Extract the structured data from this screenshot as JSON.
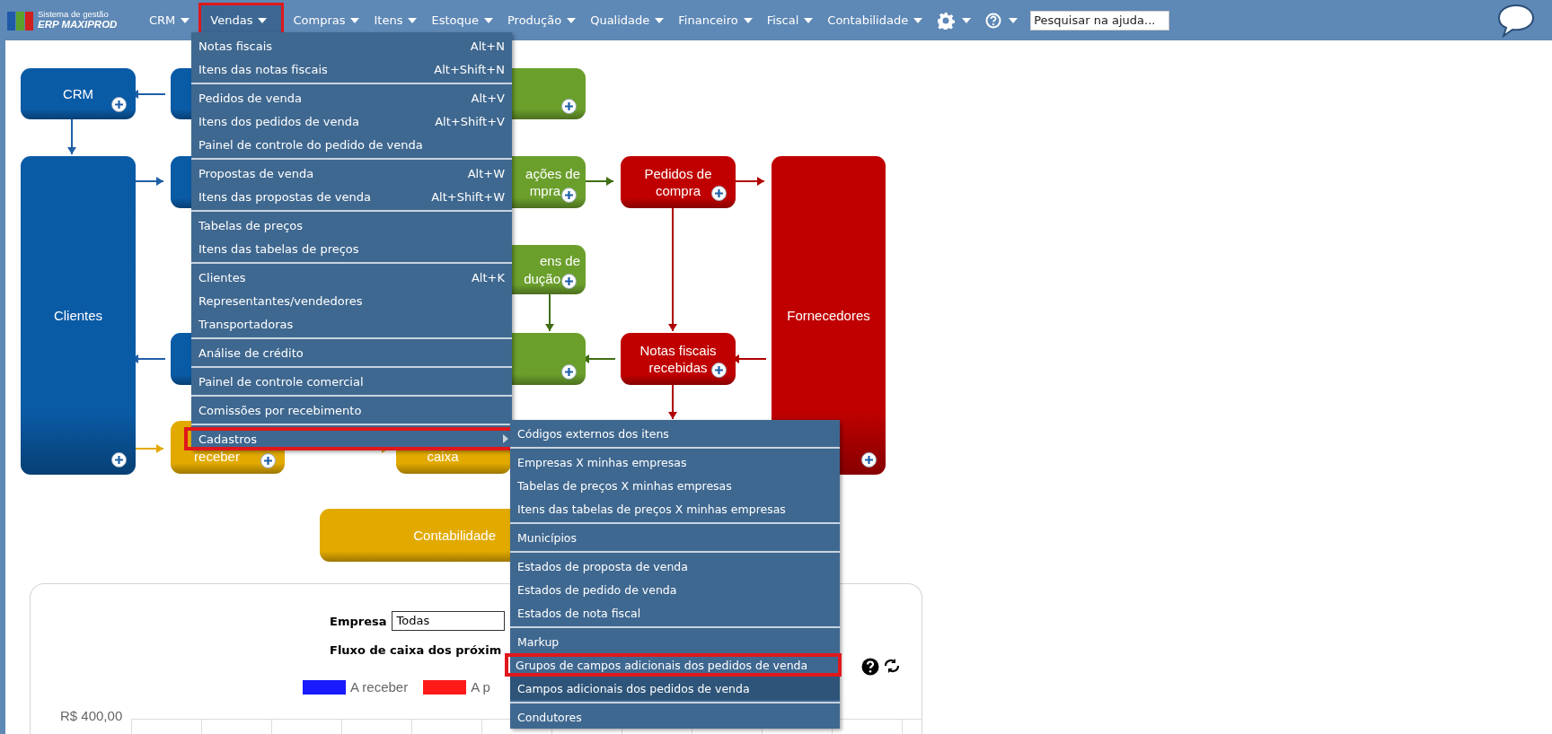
{
  "brand": {
    "subtitle": "Sistema de gestão",
    "name": "ERP MAXIPROD"
  },
  "nav": [
    {
      "label": "CRM",
      "highlighted": false
    },
    {
      "label": "Vendas",
      "highlighted": true
    },
    {
      "label": "Compras",
      "highlighted": false
    },
    {
      "label": "Itens",
      "highlighted": false
    },
    {
      "label": "Estoque",
      "highlighted": false
    },
    {
      "label": "Produção",
      "highlighted": false
    },
    {
      "label": "Qualidade",
      "highlighted": false
    },
    {
      "label": "Financeiro",
      "highlighted": false
    },
    {
      "label": "Fiscal",
      "highlighted": false
    },
    {
      "label": "Contabilidade",
      "highlighted": false
    }
  ],
  "search": {
    "placeholder": "Pesquisar na ajuda..."
  },
  "menu": {
    "groups": [
      {
        "items": [
          {
            "label": "Notas fiscais",
            "shortcut": "Alt+N",
            "highlighted": false,
            "has_submenu": false
          },
          {
            "label": "Itens das notas fiscais",
            "shortcut": "Alt+Shift+N",
            "highlighted": false,
            "has_submenu": false
          }
        ]
      },
      {
        "items": [
          {
            "label": "Pedidos de venda",
            "shortcut": "Alt+V",
            "highlighted": false,
            "has_submenu": false
          },
          {
            "label": "Itens dos pedidos de venda",
            "shortcut": "Alt+Shift+V",
            "highlighted": false,
            "has_submenu": false
          },
          {
            "label": "Painel de controle do pedido de venda",
            "highlighted": false,
            "has_submenu": false
          }
        ]
      },
      {
        "items": [
          {
            "label": "Propostas de venda",
            "shortcut": "Alt+W",
            "highlighted": false,
            "has_submenu": false
          },
          {
            "label": "Itens das propostas de venda",
            "shortcut": "Alt+Shift+W",
            "highlighted": false,
            "has_submenu": false
          }
        ]
      },
      {
        "items": [
          {
            "label": "Tabelas de preços",
            "highlighted": false,
            "has_submenu": false
          },
          {
            "label": "Itens das tabelas de preços",
            "highlighted": false,
            "has_submenu": false
          }
        ]
      },
      {
        "items": [
          {
            "label": "Clientes",
            "shortcut": "Alt+K",
            "highlighted": false,
            "has_submenu": false
          },
          {
            "label": "Representantes/vendedores",
            "highlighted": false,
            "has_submenu": false
          },
          {
            "label": "Transportadoras",
            "highlighted": false,
            "has_submenu": false
          }
        ]
      },
      {
        "items": [
          {
            "label": "Análise de crédito",
            "highlighted": false,
            "has_submenu": false
          }
        ]
      },
      {
        "items": [
          {
            "label": "Painel de controle comercial",
            "highlighted": false,
            "has_submenu": false
          }
        ]
      },
      {
        "items": [
          {
            "label": "Comissões por recebimento",
            "highlighted": false,
            "has_submenu": false
          }
        ]
      },
      {
        "items": [
          {
            "label": "Cadastros",
            "highlighted": true,
            "has_submenu": true
          }
        ]
      }
    ]
  },
  "submenu": {
    "groups": [
      {
        "items": [
          {
            "label": "Códigos externos dos itens",
            "highlighted": false,
            "selected": false
          }
        ]
      },
      {
        "items": [
          {
            "label": "Empresas X minhas empresas",
            "highlighted": false,
            "selected": false
          },
          {
            "label": "Tabelas de preços X minhas empresas",
            "highlighted": false,
            "selected": false
          },
          {
            "label": "Itens das tabelas de preços X minhas empresas",
            "highlighted": false,
            "selected": false
          }
        ]
      },
      {
        "items": [
          {
            "label": "Municípios",
            "highlighted": false,
            "selected": false
          }
        ]
      },
      {
        "items": [
          {
            "label": "Estados de proposta de venda",
            "highlighted": false,
            "selected": false
          },
          {
            "label": "Estados de pedido de venda",
            "highlighted": false,
            "selected": false
          },
          {
            "label": "Estados de nota fiscal",
            "highlighted": false,
            "selected": false
          }
        ]
      },
      {
        "items": [
          {
            "label": "Markup",
            "highlighted": false,
            "selected": false
          },
          {
            "label": "Grupos de campos adicionais dos pedidos de venda",
            "highlighted": true,
            "selected": false
          },
          {
            "label": "Campos adicionais dos pedidos de venda",
            "highlighted": false,
            "selected": true
          }
        ]
      },
      {
        "items": [
          {
            "label": "Condutores",
            "highlighted": false,
            "selected": false
          }
        ]
      }
    ]
  },
  "diagram": {
    "nodes": [
      {
        "lines": [
          "CRM"
        ],
        "color": "#0a5ba6",
        "plus": true
      },
      {
        "color": "#0a5ba6"
      },
      {
        "color": "#6b9f2c",
        "plus": true
      },
      {
        "lines": [
          "Clientes"
        ],
        "color": "#0a5ba6",
        "plus": true
      },
      {
        "color": "#0a5ba6"
      },
      {
        "lines": [
          "ações de",
          "mpra"
        ],
        "color": "#6b9f2c",
        "plus": true
      },
      {
        "lines": [
          "Pedidos de",
          "compra"
        ],
        "color": "#c00000",
        "plus": true
      },
      {
        "lines": [
          "Fornecedores"
        ],
        "color": "#c00000",
        "plus": true
      },
      {
        "lines": [
          "ens de",
          "dução"
        ],
        "color": "#6b9f2c",
        "plus": true
      },
      {
        "color": "#0a5ba6"
      },
      {
        "color": "#6b9f2c",
        "plus": true
      },
      {
        "lines": [
          "Notas fiscais",
          "recebidas"
        ],
        "color": "#c00000",
        "plus": true
      },
      {
        "lines": [
          "receber"
        ],
        "color": "#e2aa00",
        "plus": true
      },
      {
        "lines": [
          "caixa"
        ],
        "color": "#e2aa00"
      },
      {
        "lines": [
          "Contabilidade"
        ],
        "color": "#e2aa00"
      }
    ]
  },
  "cashflow": {
    "company_label": "Empresa",
    "company_value": "Todas",
    "title": "Fluxo de caixa dos próxim",
    "legend": [
      {
        "label": "A receber",
        "color": "#1a1aff"
      },
      {
        "label": "A p",
        "color": "#ff1a1a"
      }
    ],
    "y_label": "R$ 400,00"
  }
}
